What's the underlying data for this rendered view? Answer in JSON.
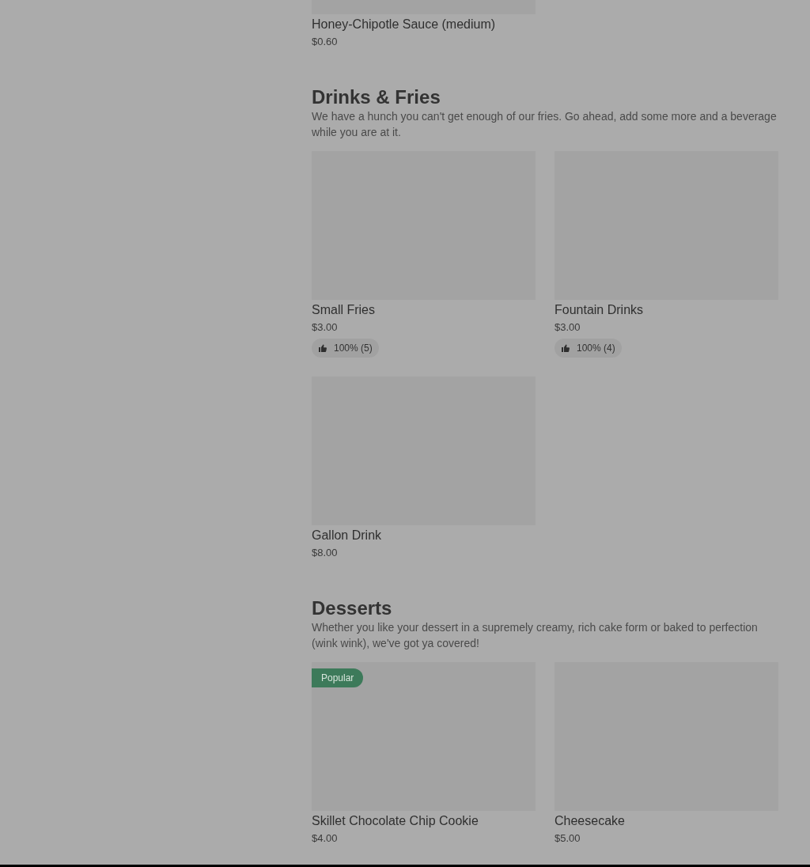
{
  "sections": [
    {
      "items": [
        {
          "name": "Honey-Chipotle Sauce (medium)",
          "price": "$0.60"
        }
      ]
    },
    {
      "title": "Drinks & Fries",
      "description": "We have a hunch you can't get enough of our fries. Go ahead, add some more and a beverage while you are at it.",
      "items": [
        {
          "name": "Small Fries",
          "price": "$3.00",
          "rating": "100% (5)"
        },
        {
          "name": "Fountain Drinks",
          "price": "$3.00",
          "rating": "100% (4)"
        },
        {
          "name": "Gallon Drink",
          "price": "$8.00"
        }
      ]
    },
    {
      "title": "Desserts",
      "description": "Whether you like your dessert in a supremely creamy, rich cake form or baked to perfection (wink wink), we've got ya covered!",
      "items": [
        {
          "name": "Skillet Chocolate Chip Cookie",
          "price": "$4.00",
          "badge": "Popular"
        },
        {
          "name": "Cheesecake",
          "price": "$5.00"
        }
      ]
    }
  ]
}
